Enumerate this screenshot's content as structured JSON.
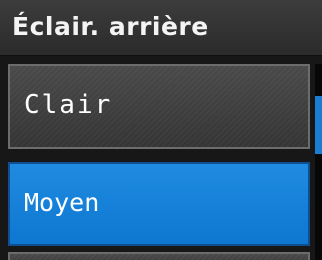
{
  "screen": {
    "title": "Éclair. arrière"
  },
  "menu": {
    "items": [
      {
        "label": "Clair",
        "selected": false
      },
      {
        "label": "Moyen",
        "selected": true
      },
      {
        "label": "",
        "selected": false
      }
    ]
  },
  "colors": {
    "selected": "#0e77d1",
    "item_bg": "#3b3b3b",
    "header_bg": "#333333",
    "text": "#ffffff"
  }
}
